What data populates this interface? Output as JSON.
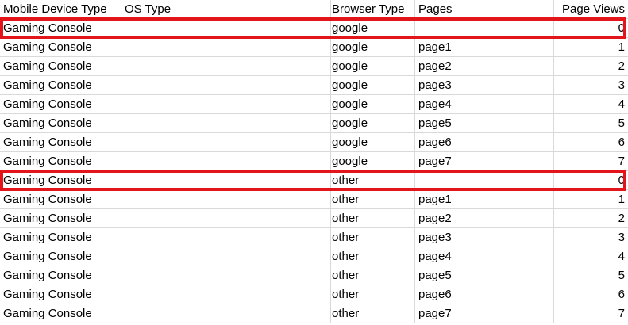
{
  "headers": [
    "Mobile Device Type",
    "OS Type",
    "Browser Type",
    "Pages",
    "Page Views"
  ],
  "rows": [
    [
      "Gaming Console",
      "",
      "google",
      "",
      "0"
    ],
    [
      "Gaming Console",
      "",
      "google",
      "page1",
      "1"
    ],
    [
      "Gaming Console",
      "",
      "google",
      "page2",
      "2"
    ],
    [
      "Gaming Console",
      "",
      "google",
      "page3",
      "3"
    ],
    [
      "Gaming Console",
      "",
      "google",
      "page4",
      "4"
    ],
    [
      "Gaming Console",
      "",
      "google",
      "page5",
      "5"
    ],
    [
      "Gaming Console",
      "",
      "google",
      "page6",
      "6"
    ],
    [
      "Gaming Console",
      "",
      "google",
      "page7",
      "7"
    ],
    [
      "Gaming Console",
      "",
      "other",
      "",
      "0"
    ],
    [
      "Gaming Console",
      "",
      "other",
      "page1",
      "1"
    ],
    [
      "Gaming Console",
      "",
      "other",
      "page2",
      "2"
    ],
    [
      "Gaming Console",
      "",
      "other",
      "page3",
      "3"
    ],
    [
      "Gaming Console",
      "",
      "other",
      "page4",
      "4"
    ],
    [
      "Gaming Console",
      "",
      "other",
      "page5",
      "5"
    ],
    [
      "Gaming Console",
      "",
      "other",
      "page6",
      "6"
    ],
    [
      "Gaming Console",
      "",
      "other",
      "page7",
      "7"
    ]
  ],
  "highlighted_rows": [
    0,
    8
  ],
  "highlight_color": "#e3151a",
  "gridline_color": "#d9d9d9"
}
